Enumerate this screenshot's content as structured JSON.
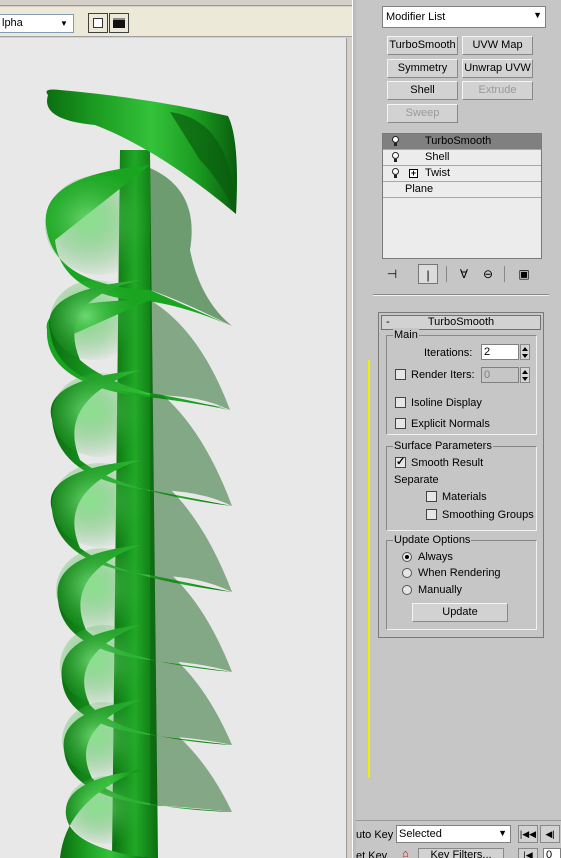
{
  "render_window": {
    "channel": "lpha",
    "channel_arrow": "▼"
  },
  "command_panel": {
    "modifier_list": {
      "label": "Modifier List",
      "arrow": "▼"
    },
    "buttons": [
      {
        "label": "TurboSmooth",
        "enabled": true
      },
      {
        "label": "UVW Map",
        "enabled": true
      },
      {
        "label": "Symmetry",
        "enabled": true
      },
      {
        "label": "Unwrap UVW",
        "enabled": true
      },
      {
        "label": "Shell",
        "enabled": true
      },
      {
        "label": "Extrude",
        "enabled": false
      },
      {
        "label": "Sweep",
        "enabled": false
      }
    ],
    "stack": [
      {
        "label": "TurboSmooth",
        "selected": true,
        "bulb": true,
        "expander": false
      },
      {
        "label": "Shell",
        "selected": false,
        "bulb": true,
        "expander": false
      },
      {
        "label": "Twist",
        "selected": false,
        "bulb": true,
        "expander": true
      },
      {
        "label": "Plane",
        "selected": false,
        "bulb": false,
        "expander": false
      }
    ],
    "stack_tools": [
      "pin-stack",
      "show-end-result",
      "make-unique",
      "remove-modifier",
      "configure-modifier-sets"
    ]
  },
  "turbosmooth": {
    "header": "TurboSmooth",
    "collapse_symbol": "-",
    "main_group": "Main",
    "iterations_label": "Iterations:",
    "iterations_value": "2",
    "render_iters_label": "Render Iters:",
    "render_iters_value": "0",
    "render_iters_checked": false,
    "isoline_label": "Isoline Display",
    "isoline_checked": false,
    "explicit_normals_label": "Explicit Normals",
    "explicit_normals_checked": false,
    "surface_group": "Surface Parameters",
    "smooth_result_label": "Smooth Result",
    "smooth_result_checked": true,
    "check_mark": "✓",
    "separate_label": "Separate",
    "materials_label": "Materials",
    "materials_checked": false,
    "smoothing_groups_label": "Smoothing Groups",
    "smoothing_groups_checked": false,
    "update_group": "Update Options",
    "update_options": [
      {
        "label": "Always",
        "selected": true
      },
      {
        "label": "When Rendering",
        "selected": false
      },
      {
        "label": "Manually",
        "selected": false
      }
    ],
    "update_button": "Update"
  },
  "trackbar": {
    "auto_key_label": "uto Key",
    "set_key_label": "et Key",
    "selection_set": "Selected",
    "selection_arrow": "▼",
    "key_filters": "Key Filters...",
    "frame_value": "0"
  },
  "colors": {
    "helix_green": "#19a51f",
    "render_bg": "#e8e8e8",
    "panel_bg": "#c6c6c6",
    "active_viewport_border": "#f0f000"
  }
}
